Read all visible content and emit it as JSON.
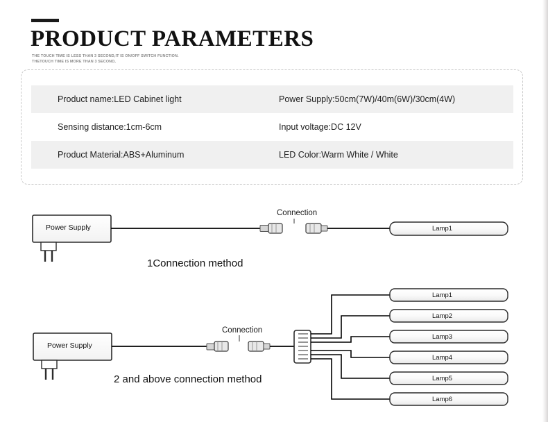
{
  "header": {
    "title": "PRODUCT PARAMETERS",
    "subtitle_line1": "THE TOUCH TIME IS LESS THAN 3 SECOND,IT IS ON/OFF SWITCH FUNCTION.",
    "subtitle_line2": "THETOUCH TIME IS MORE THAN 3 SECOND,"
  },
  "specs": {
    "rows": [
      {
        "left": "Product name:LED Cabinet light",
        "right": "Power Supply:50cm(7W)/40m(6W)/30cm(4W)"
      },
      {
        "left": "Sensing distance:1cm-6cm",
        "right": "Input voltage:DC 12V"
      },
      {
        "left": "Product Material:ABS+Aluminum",
        "right": "LED Color:Warm White / White"
      }
    ]
  },
  "diagram1": {
    "power_supply_label": "Power Supply",
    "connection_label": "Connection",
    "lamp_label": "Lamp1",
    "caption": "1Connection method"
  },
  "diagram2": {
    "power_supply_label": "Power Supply",
    "connection_label": "Connection",
    "caption": "2 and above connection method",
    "lamps": [
      "Lamp1",
      "Lamp2",
      "Lamp3",
      "Lamp4",
      "Lamp5",
      "Lamp6"
    ]
  },
  "colors": {
    "text": "#1a1a1a",
    "row_alt": "#f0f0f0",
    "panel_border": "#c9c9c9",
    "wire": "#000000"
  }
}
